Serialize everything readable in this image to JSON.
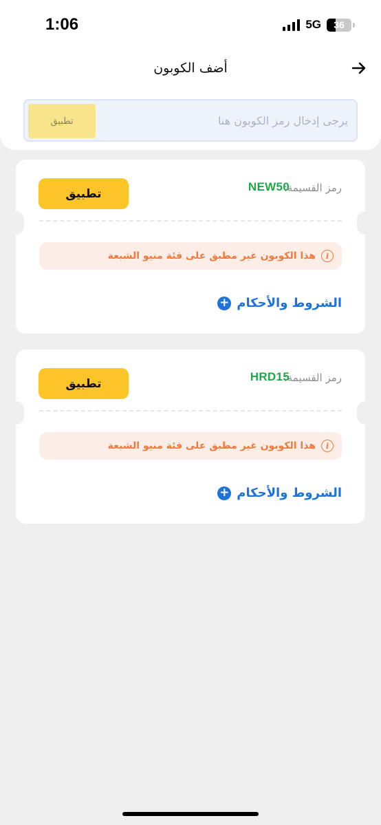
{
  "status_bar": {
    "time": "1:06",
    "network": "5G",
    "battery_level": "36",
    "battery_fraction": 0.36
  },
  "header": {
    "title": "أضف الكوبون",
    "back_icon": "arrow-right-icon"
  },
  "coupon_input": {
    "placeholder": "يرجى إدخال رمز الكوبون هنا",
    "value": "",
    "apply_label": "تطبيق"
  },
  "coupons": [
    {
      "code_label": "رمز القسيمة:",
      "code": "NEW50",
      "apply_label": "تطبيق",
      "warning": "هذا الكوبون غير مطبق على فئة منيو الشبعة",
      "terms_label": "الشروط والأحكام"
    },
    {
      "code_label": "رمز القسيمة:",
      "code": "HRD15",
      "apply_label": "تطبيق",
      "warning": "هذا الكوبون غير مطبق على فئة منيو الشبعة",
      "terms_label": "الشروط والأحكام"
    }
  ],
  "colors": {
    "accent_yellow": "#fbc52a",
    "code_green": "#1fa84a",
    "warning_orange": "#ef7a3c",
    "link_blue": "#1e72d8"
  }
}
